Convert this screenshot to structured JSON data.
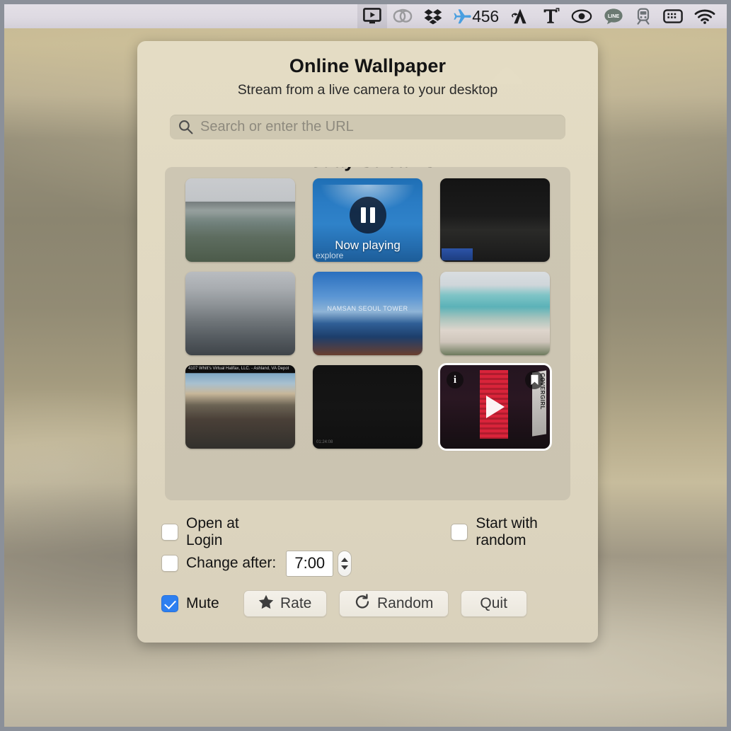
{
  "menubar": {
    "items": [
      {
        "name": "online-wallpaper-menu-icon",
        "icon": "monitor-play-icon",
        "label": ""
      },
      {
        "name": "creative-cloud-icon",
        "icon": "creative-cloud-icon",
        "label": ""
      },
      {
        "name": "dropbox-icon",
        "icon": "dropbox-icon",
        "label": ""
      },
      {
        "name": "airmail-icon",
        "icon": "airplane-icon",
        "label": "456"
      },
      {
        "name": "alfred-icon",
        "icon": "a-logo-icon",
        "label": ""
      },
      {
        "name": "textexpander-icon",
        "icon": "letter-t-icon",
        "label": ""
      },
      {
        "name": "eye-icon",
        "icon": "eye-icon",
        "label": ""
      },
      {
        "name": "line-icon",
        "icon": "line-bubble-icon",
        "label": "LINE"
      },
      {
        "name": "train-icon",
        "icon": "train-icon",
        "label": ""
      },
      {
        "name": "keyboard-icon",
        "icon": "keyboard-icon",
        "label": ""
      },
      {
        "name": "wifi-icon",
        "icon": "wifi-icon",
        "label": ""
      }
    ],
    "badge_count": "456",
    "line_label": "LINE"
  },
  "popover": {
    "title": "Online Wallpaper",
    "subtitle": "Stream from a live camera to your desktop",
    "search": {
      "placeholder": "Search or enter the URL",
      "value": "",
      "icon": "search-icon"
    },
    "grid": {
      "header": "Today Streams",
      "thumbs": [
        {
          "name": "thumb-nyc-bridge",
          "art": "t-nyc",
          "overlay": "none",
          "caption": ""
        },
        {
          "name": "thumb-now-playing-wave",
          "art": "t-wave",
          "overlay": "now-playing",
          "caption": "Now playing",
          "watermark": "explore"
        },
        {
          "name": "thumb-night-coast",
          "art": "t-dark1",
          "overlay": "none",
          "caption": ""
        },
        {
          "name": "thumb-city-skyline",
          "art": "t-city2",
          "overlay": "none",
          "caption": ""
        },
        {
          "name": "thumb-namsan-seoul-tower",
          "art": "t-seoul",
          "overlay": "none",
          "caption": "NAMSAN SEOUL TOWER"
        },
        {
          "name": "thumb-beach",
          "art": "t-beach",
          "overlay": "none",
          "caption": ""
        },
        {
          "name": "thumb-railroad-depot",
          "art": "t-town",
          "overlay": "none",
          "caption": "4107 Whitt's  Virtual Halifax, LLC. - Ashland, VA Depot"
        },
        {
          "name": "thumb-dark-night-cam",
          "art": "t-dark2",
          "overlay": "none",
          "caption": "",
          "stamp": "01:24:08"
        },
        {
          "name": "thumb-times-square-coke",
          "art": "t-coke",
          "overlay": "hover",
          "caption": "COVERGIRL",
          "selected": true
        }
      ]
    },
    "options": {
      "open_at_login": {
        "label": "Open at Login",
        "checked": false
      },
      "start_with_random": {
        "label": "Start with random",
        "checked": false
      },
      "change_after": {
        "label": "Change after:",
        "checked": false,
        "value": "7:00"
      },
      "mute": {
        "label": "Mute",
        "checked": true
      }
    },
    "buttons": {
      "rate": {
        "label": "Rate",
        "icon": "star-icon"
      },
      "random": {
        "label": "Random",
        "icon": "refresh-icon"
      },
      "quit": {
        "label": "Quit",
        "icon": "none"
      }
    }
  },
  "colors": {
    "popover_bg": "#e1d9c2",
    "grid_bg": "#cbc4b1",
    "accent_checkbox": "#2d7ff0",
    "menubar_bg": "#dedae2",
    "text_primary": "#131313"
  }
}
